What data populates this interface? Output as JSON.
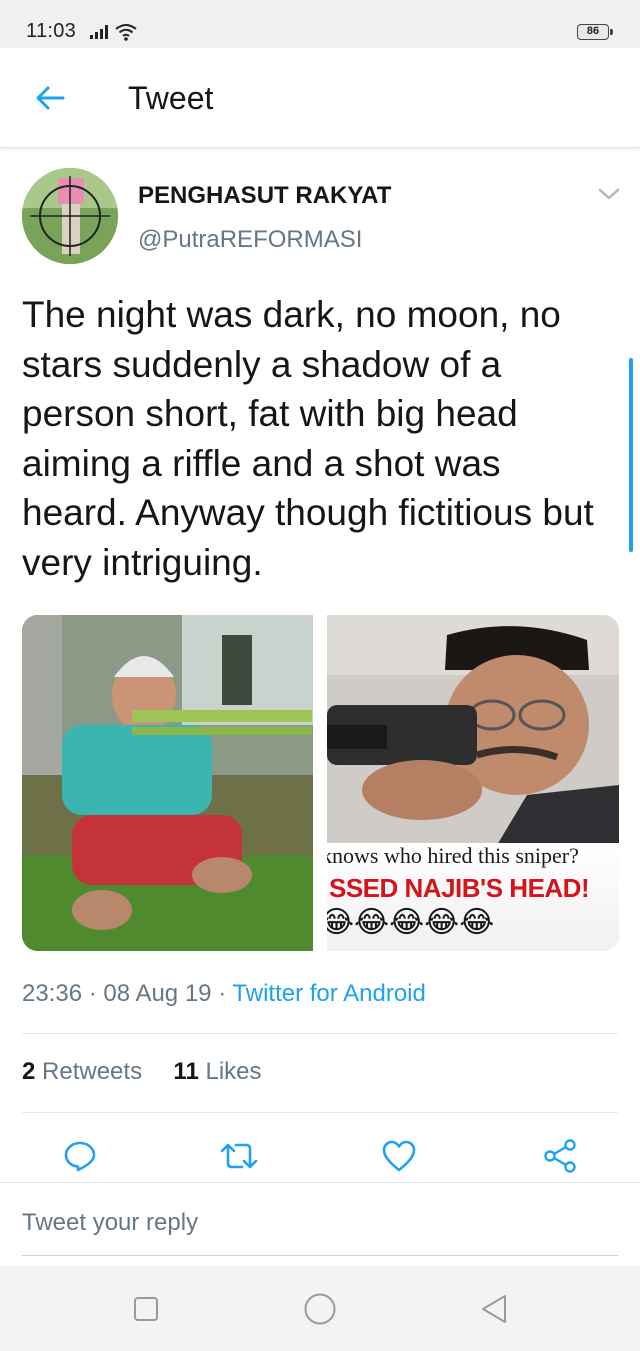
{
  "status_bar": {
    "time": "11:03",
    "battery": "86"
  },
  "app_bar": {
    "title": "Tweet"
  },
  "tweet": {
    "display_name": "PENGHASUT RAKYAT",
    "handle": "@PutraREFORMASI",
    "text": "The night was dark, no moon, no stars suddenly a shadow of a person short, fat with big head aiming a riffle and a shot was heard. Anyway though fictitious but very intriguing.",
    "media": {
      "right_caption_line1": "knows who hired this sniper?",
      "right_caption_line2": "SSED NAJIB'S HEAD!",
      "right_emojis": "😂😂😂😂😂"
    },
    "time": "23:36",
    "date": "08 Aug 19",
    "source": "Twitter for Android",
    "retweets_count": "2",
    "retweets_label": "Retweets",
    "likes_count": "11",
    "likes_label": "Likes"
  },
  "reply": {
    "placeholder": "Tweet your reply"
  },
  "colors": {
    "accent": "#1da1f2",
    "secondary_text": "#657786",
    "caption_red": "#d6131a"
  },
  "icons": {
    "back": "arrow-left-icon",
    "caret": "chevron-down-icon",
    "reply": "comment-icon",
    "retweet": "retweet-icon",
    "like": "heart-icon",
    "share": "share-icon"
  }
}
